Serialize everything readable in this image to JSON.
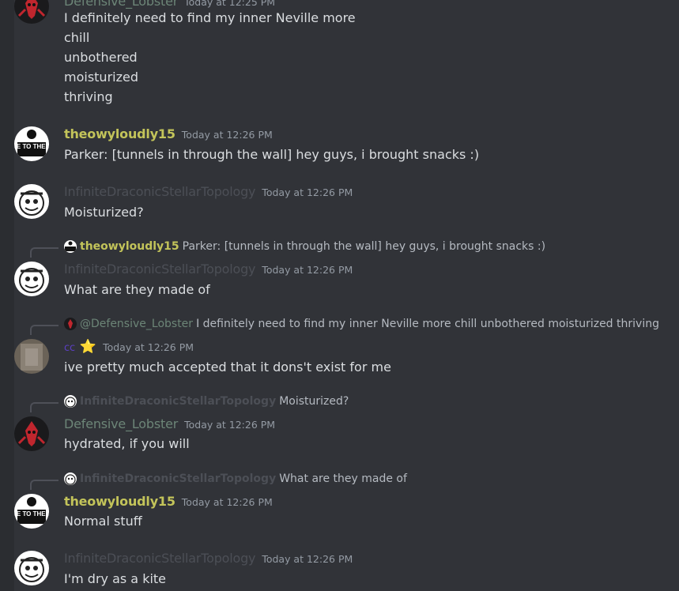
{
  "colors": {
    "background": "#313338",
    "theowyloudly15": "#c3c45a",
    "idst": "#4c4f56",
    "lobster": "#6c8577",
    "cc": "#5b3fc0"
  },
  "messages": {
    "m0": {
      "author": "Defensive_Lobster",
      "time": "Today at 12:25 PM",
      "lines": [
        "I definitely need to find my inner Neville more",
        "chill",
        "unbothered",
        "moisturized",
        "thriving"
      ]
    },
    "m1": {
      "author": "theowyloudly15",
      "time": "Today at 12:26 PM",
      "text": "Parker: [tunnels in through the wall] hey guys, i brought snacks :)"
    },
    "m2": {
      "author": "InfiniteDraconicStellarTopology",
      "time": "Today at 12:26 PM",
      "text": "Moisturized?"
    },
    "m3": {
      "reply_author": "theowyloudly15",
      "reply_text": "Parker: [tunnels in through the wall] hey guys, i brought snacks :)",
      "author": "InfiniteDraconicStellarTopology",
      "time": "Today at 12:26 PM",
      "text": "What are they made of"
    },
    "m4": {
      "reply_author": "@Defensive_Lobster",
      "reply_text": "I definitely need to find my inner Neville more chill unbothered moisturized thriving",
      "author": "cc",
      "badge": "⭐",
      "time": "Today at 12:26 PM",
      "text": "ive pretty much accepted that it dons't exist for me"
    },
    "m5": {
      "reply_author": "InfiniteDraconicStellarTopology",
      "reply_text": "Moisturized?",
      "author": "Defensive_Lobster",
      "time": "Today at 12:26 PM",
      "text": "hydrated, if you will"
    },
    "m6": {
      "reply_author": "InfiniteDraconicStellarTopology",
      "reply_text": "What are they made of",
      "author": "theowyloudly15",
      "time": "Today at 12:26 PM",
      "text": "Normal stuff"
    },
    "m7": {
      "author": "InfiniteDraconicStellarTopology",
      "time": "Today at 12:26 PM",
      "text": "I'm dry as a kite"
    }
  },
  "avatars": {
    "theowyloudly15_text": "WAVE TO THE NSA"
  }
}
